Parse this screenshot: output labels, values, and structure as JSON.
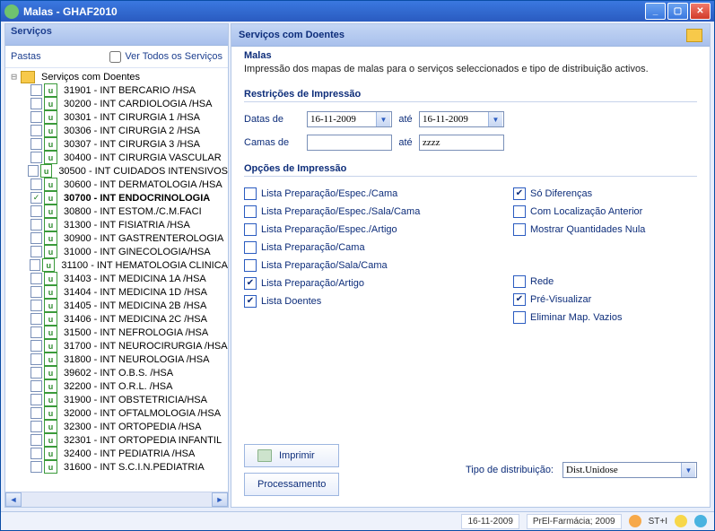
{
  "window": {
    "title": "Malas - GHAF2010"
  },
  "sidebar": {
    "header": "Serviços",
    "pastas_label": "Pastas",
    "ver_todos": "Ver Todos os Serviços",
    "root": "Serviços com Doentes",
    "items": [
      {
        "label": "31901 - INT BERCARIO /HSA",
        "checked": false,
        "selected": false
      },
      {
        "label": "30200 - INT CARDIOLOGIA /HSA",
        "checked": false,
        "selected": false
      },
      {
        "label": "30301 - INT CIRURGIA 1 /HSA",
        "checked": false,
        "selected": false
      },
      {
        "label": "30306 - INT CIRURGIA 2 /HSA",
        "checked": false,
        "selected": false
      },
      {
        "label": "30307 - INT CIRURGIA 3 /HSA",
        "checked": false,
        "selected": false
      },
      {
        "label": "30400 - INT CIRURGIA VASCULAR",
        "checked": false,
        "selected": false
      },
      {
        "label": "30500 - INT CUIDADOS INTENSIVOS",
        "checked": false,
        "selected": false
      },
      {
        "label": "30600 - INT DERMATOLOGIA /HSA",
        "checked": false,
        "selected": false
      },
      {
        "label": "30700 - INT ENDOCRINOLOGIA",
        "checked": true,
        "selected": true
      },
      {
        "label": "30800 - INT ESTOM./C.M.FACI",
        "checked": false,
        "selected": false
      },
      {
        "label": "31300 - INT FISIATRIA /HSA",
        "checked": false,
        "selected": false
      },
      {
        "label": "30900 - INT GASTRENTEROLOGIA",
        "checked": false,
        "selected": false
      },
      {
        "label": "31000 - INT GINECOLOGIA/HSA",
        "checked": false,
        "selected": false
      },
      {
        "label": "31100 - INT HEMATOLOGIA CLINICA",
        "checked": false,
        "selected": false
      },
      {
        "label": "31403 - INT MEDICINA 1A /HSA",
        "checked": false,
        "selected": false
      },
      {
        "label": "31404 - INT MEDICINA 1D /HSA",
        "checked": false,
        "selected": false
      },
      {
        "label": "31405 - INT MEDICINA 2B /HSA",
        "checked": false,
        "selected": false
      },
      {
        "label": "31406 - INT MEDICINA 2C /HSA",
        "checked": false,
        "selected": false
      },
      {
        "label": "31500 - INT NEFROLOGIA /HSA",
        "checked": false,
        "selected": false
      },
      {
        "label": "31700 - INT NEUROCIRURGIA /HSA",
        "checked": false,
        "selected": false
      },
      {
        "label": "31800 - INT NEUROLOGIA /HSA",
        "checked": false,
        "selected": false
      },
      {
        "label": "39602 - INT O.B.S. /HSA",
        "checked": false,
        "selected": false
      },
      {
        "label": "32200 - INT O.R.L. /HSA",
        "checked": false,
        "selected": false
      },
      {
        "label": "31900 - INT OBSTETRICIA/HSA",
        "checked": false,
        "selected": false
      },
      {
        "label": "32000 - INT OFTALMOLOGIA /HSA",
        "checked": false,
        "selected": false
      },
      {
        "label": "32300 - INT ORTOPEDIA /HSA",
        "checked": false,
        "selected": false
      },
      {
        "label": "32301 - INT ORTOPEDIA INFANTIL",
        "checked": false,
        "selected": false
      },
      {
        "label": "32400 - INT PEDIATRIA /HSA",
        "checked": false,
        "selected": false
      },
      {
        "label": "31600 - INT S.C.I.N.PEDIATRIA",
        "checked": false,
        "selected": false
      }
    ]
  },
  "main": {
    "title": "Serviços com Doentes",
    "info_heading": "Malas",
    "info_desc": "Impressão dos mapas de malas para o serviços seleccionados e tipo de distribuição activos.",
    "restr_heading": "Restrições de Impressão",
    "dates_label": "Datas de",
    "ate": "até",
    "date_from": "16-11-2009",
    "date_to": "16-11-2009",
    "camas_label": "Camas de",
    "camas_from": "",
    "camas_to": "zzzz",
    "opts_heading": "Opções de Impressão",
    "opts_col1": [
      {
        "label": "Lista Preparação/Espec./Cama",
        "checked": false
      },
      {
        "label": "Lista Preparação/Espec./Sala/Cama",
        "checked": false
      },
      {
        "label": "Lista Preparação/Espec./Artigo",
        "checked": false
      },
      {
        "label": "Lista Preparação/Cama",
        "checked": false
      },
      {
        "label": "Lista Preparação/Sala/Cama",
        "checked": false
      },
      {
        "label": "Lista Preparação/Artigo",
        "checked": true
      },
      {
        "label": "Lista Doentes",
        "checked": true
      }
    ],
    "opts_col2": [
      {
        "label": "Só Diferenças",
        "checked": true
      },
      {
        "label": "Com Localização Anterior",
        "checked": false
      },
      {
        "label": "Mostrar  Quantidades Nula",
        "checked": false
      },
      {
        "label": "",
        "checked": null
      },
      {
        "label": "",
        "checked": null
      },
      {
        "label": "Rede",
        "checked": false
      },
      {
        "label": "Pré-Visualizar",
        "checked": true
      },
      {
        "label": "Eliminar Map. Vazios",
        "checked": false
      }
    ],
    "btn_imprimir": "Imprimir",
    "btn_processamento": "Processamento",
    "dist_label": "Tipo de distribuição:",
    "dist_value": "Dist.Unidose"
  },
  "status": {
    "date": "16-11-2009",
    "org": "PrEl-Farmácia; 2009",
    "user": "ST+I"
  }
}
